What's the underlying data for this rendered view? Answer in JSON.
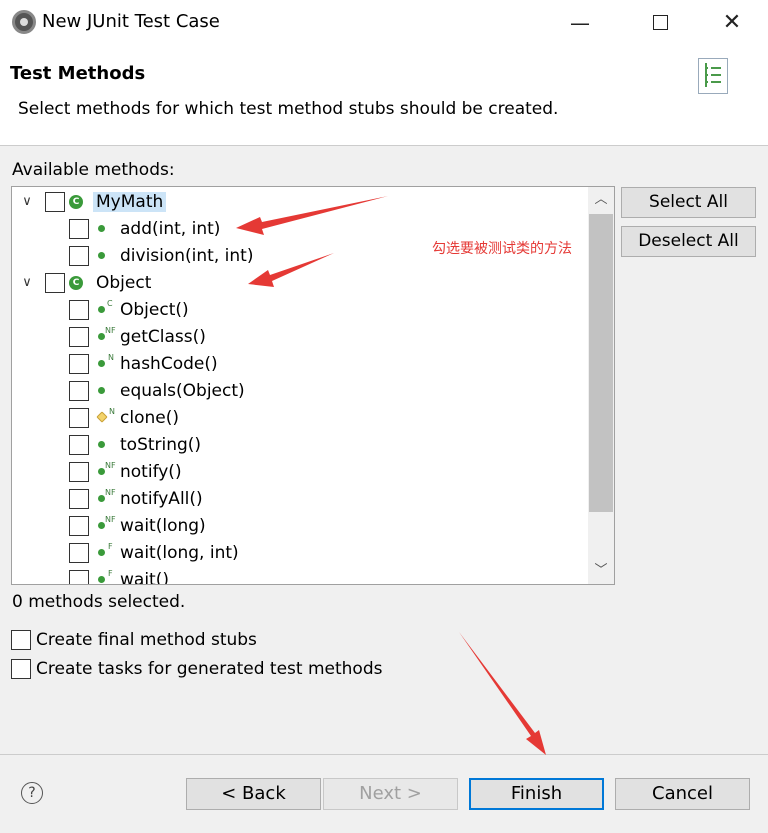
{
  "window": {
    "title": "New JUnit Test Case"
  },
  "header": {
    "title": "Test Methods",
    "description": "Select methods for which test method stubs should be created."
  },
  "methods": {
    "label": "Available methods:",
    "classes": [
      {
        "name": "MyMath",
        "selected": true,
        "members": [
          {
            "label": "add(int, int)",
            "modifier": ""
          },
          {
            "label": "division(int, int)",
            "modifier": ""
          }
        ]
      },
      {
        "name": "Object",
        "selected": false,
        "members": [
          {
            "label": "Object()",
            "modifier": "C"
          },
          {
            "label": "getClass()",
            "modifier": "NF"
          },
          {
            "label": "hashCode()",
            "modifier": "N"
          },
          {
            "label": "equals(Object)",
            "modifier": ""
          },
          {
            "label": "clone()",
            "modifier": "N"
          },
          {
            "label": "toString()",
            "modifier": ""
          },
          {
            "label": "notify()",
            "modifier": "NF"
          },
          {
            "label": "notifyAll()",
            "modifier": "NF"
          },
          {
            "label": "wait(long)",
            "modifier": "NF"
          },
          {
            "label": "wait(long, int)",
            "modifier": "F"
          },
          {
            "label": "wait()",
            "modifier": "F"
          }
        ]
      }
    ],
    "class_badge": "C",
    "count": "0 methods selected."
  },
  "side_buttons": {
    "select_all": "Select All",
    "deselect_all": "Deselect All"
  },
  "options": {
    "final_stubs": "Create final method stubs",
    "tasks": "Create tasks for generated test methods"
  },
  "footer": {
    "help": "?",
    "back": "< Back",
    "next": "Next >",
    "finish": "Finish",
    "cancel": "Cancel"
  },
  "annotation": {
    "text": "勾选要被测试类的方法",
    "color": "#e53935"
  },
  "icons": {
    "expand": "chevron-down-icon",
    "scroll_up": "scroll-up-icon",
    "scroll_down": "scroll-down-icon"
  }
}
